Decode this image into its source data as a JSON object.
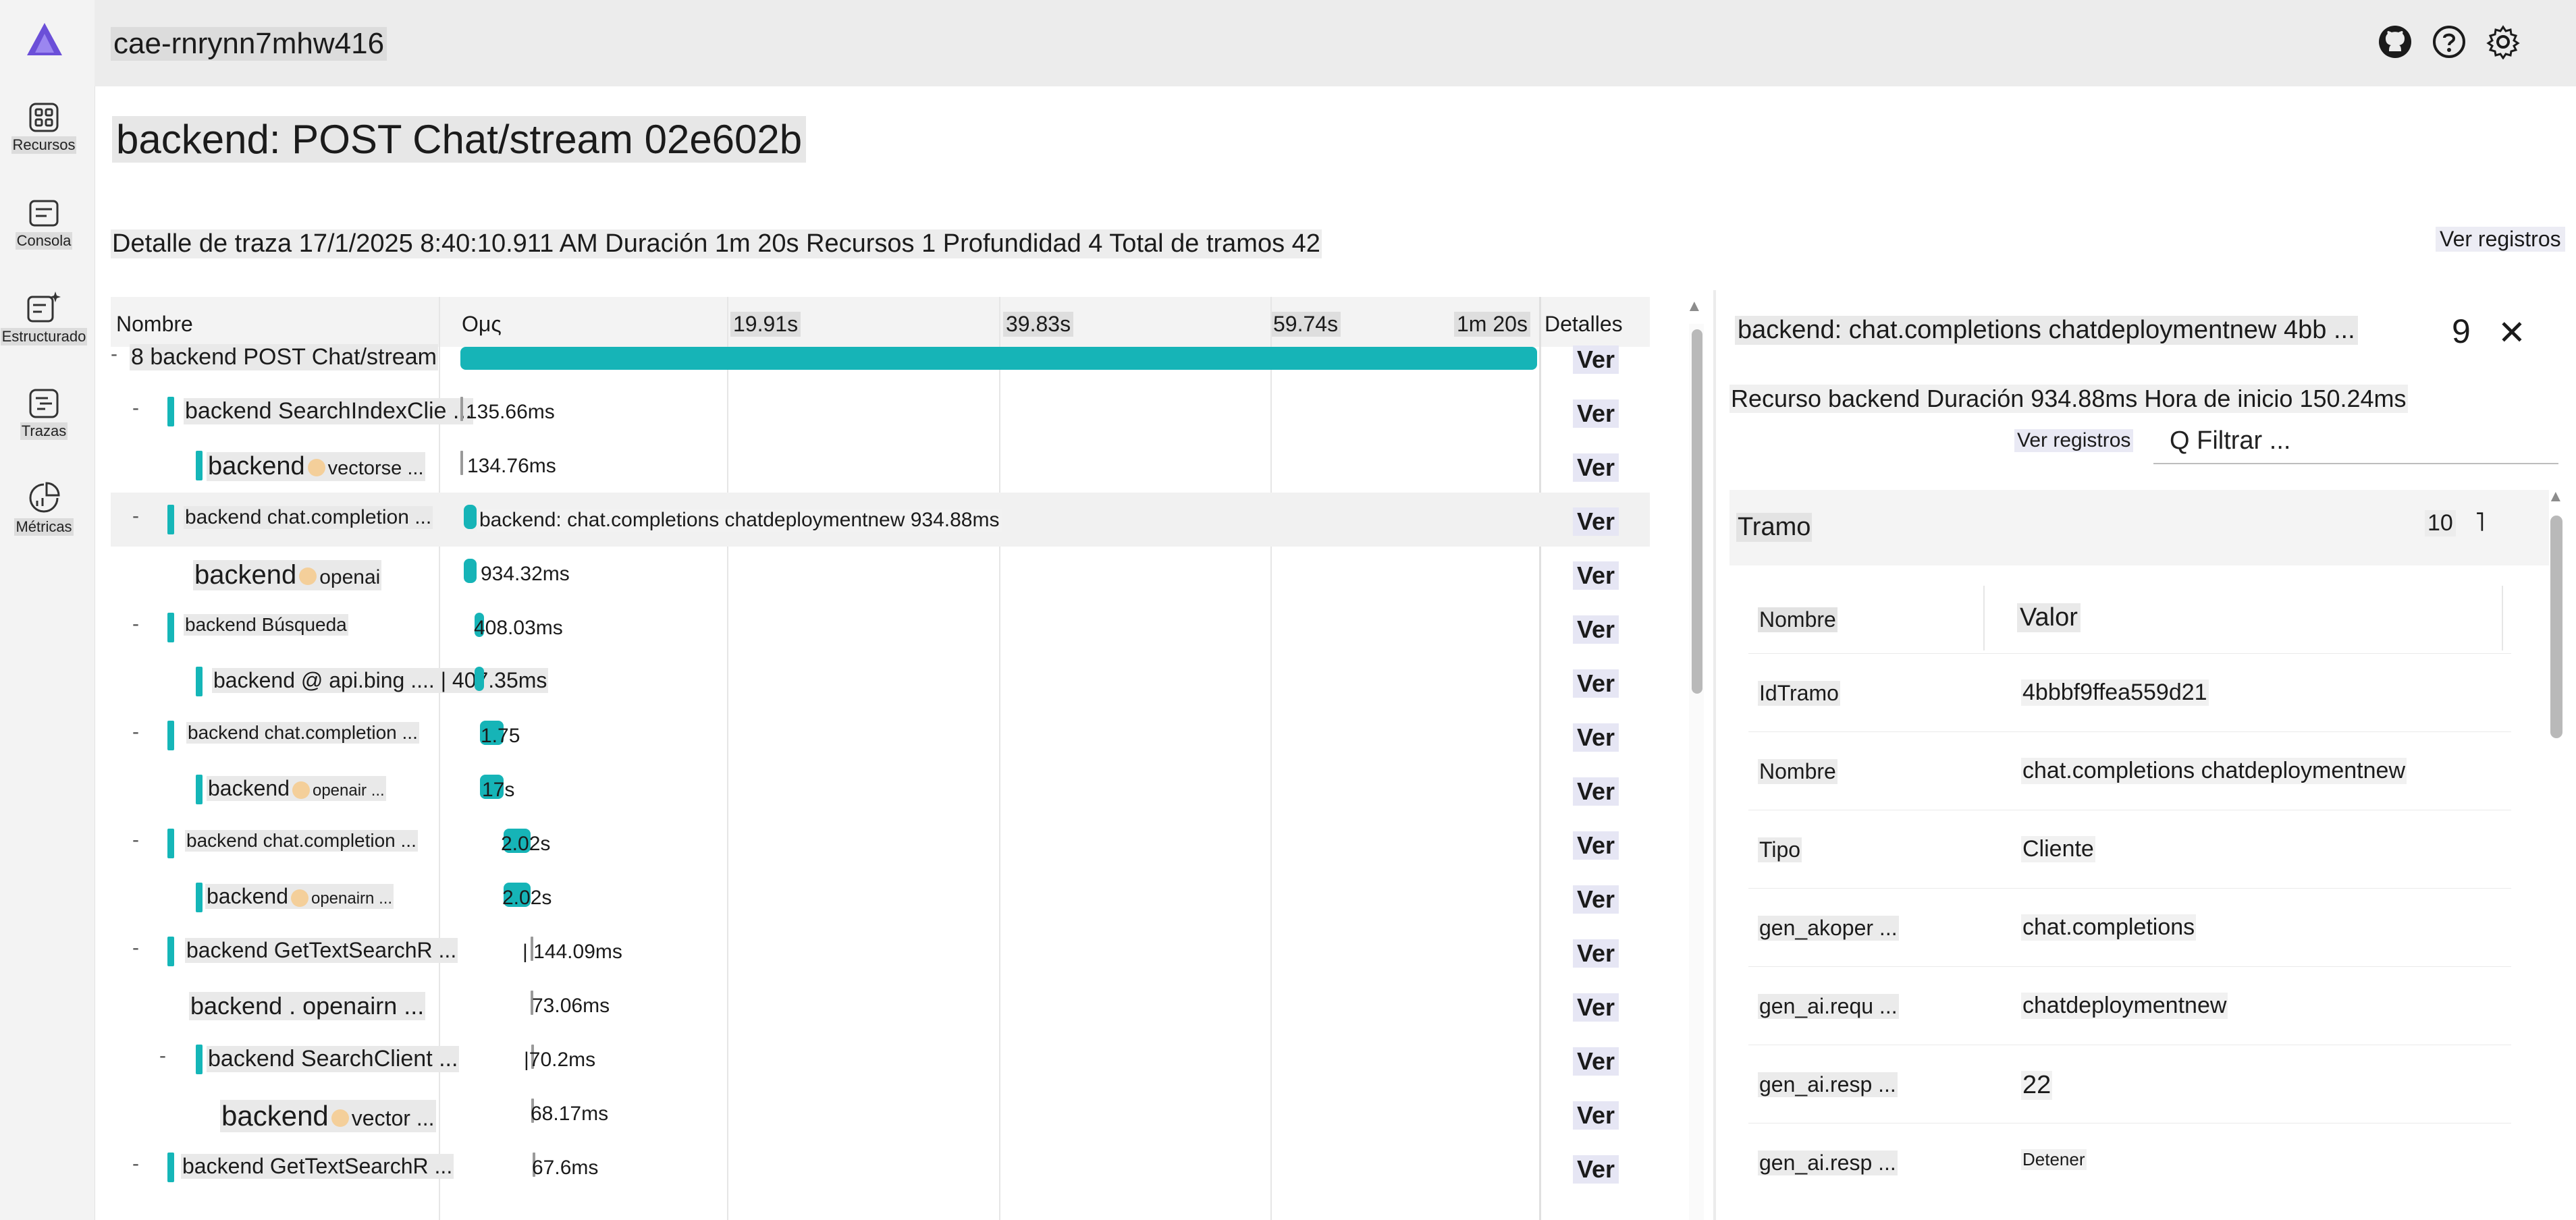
{
  "app": {
    "name": "cae-rnrynn7mhw416"
  },
  "rail": [
    {
      "label": "Recursos",
      "icon": "resources-grid-icon"
    },
    {
      "label": "Consola",
      "icon": "console-icon"
    },
    {
      "label": "Estructurado",
      "icon": "structured-logs-icon"
    },
    {
      "label": "Trazas",
      "icon": "traces-icon"
    },
    {
      "label": "Métricas",
      "icon": "metrics-icon"
    }
  ],
  "header_icons": [
    "github-icon",
    "help-icon",
    "settings-gear-icon"
  ],
  "page": {
    "title": "backend: POST Chat/stream 02e602b",
    "detail": "Detalle de traza 17/1/2025 8:40:10.911 AM Duración 1m 20s Recursos 1 Profundidad 4 Total de tramos 42",
    "view_logs": "Ver registros"
  },
  "table": {
    "col_name": "Nombre",
    "col_details": "Detalles",
    "ticks": [
      "Ομς",
      "19.91s",
      "39.83s",
      "59.74s",
      "1m 20s"
    ],
    "view_label": "Ver",
    "rows": [
      {
        "toggle": "-",
        "name": "8 backend POST Chat/stream",
        "dur": "",
        "bar_start": 0.0,
        "bar_frac": 1.0
      },
      {
        "toggle": "-",
        "name": "backend SearchIndexClie ...",
        "dur": "135.66ms",
        "bar_start": 0.0,
        "bar_frac": 0.0017
      },
      {
        "toggle": "",
        "svc": "backend",
        "sub": "vectorse ...",
        "dur": "134.76ms",
        "bar_start": 0.0,
        "bar_frac": 0.0017
      },
      {
        "toggle": "-",
        "name": "backend chat.completion ...",
        "dur": "backend: chat.completions chatdeploymentnew 934.88ms",
        "bar_start": 0.003,
        "bar_frac": 0.012
      },
      {
        "toggle": "",
        "svc": "backend",
        "sub": "openai",
        "dur": "934.32ms",
        "bar_start": 0.003,
        "bar_frac": 0.012
      },
      {
        "toggle": "-",
        "name": "backend Búsqueda",
        "dur": "408.03ms",
        "bar_start": 0.013,
        "bar_frac": 0.005
      },
      {
        "toggle": "",
        "name": "backend @ api.bing .... | 407.35ms",
        "dur": "",
        "bar_start": 0.013,
        "bar_frac": 0.005
      },
      {
        "toggle": "-",
        "name": "backend chat.completion ...",
        "dur": "1.75",
        "bar_start": 0.018,
        "bar_frac": 0.022
      },
      {
        "toggle": "",
        "svc": "backend",
        "sub": "openair ...",
        "dur": "17s",
        "bar_start": 0.018,
        "bar_frac": 0.022
      },
      {
        "toggle": "-",
        "name": "backend chat.completion ...",
        "dur": "2.02s",
        "bar_start": 0.04,
        "bar_frac": 0.025
      },
      {
        "toggle": "",
        "svc": "backend",
        "sub": "openairn ...",
        "dur": "2.02s",
        "bar_start": 0.04,
        "bar_frac": 0.025
      },
      {
        "toggle": "-",
        "name": "backend GetTextSearchR ...",
        "dur": "| 144.09ms",
        "bar_start": 0.065,
        "bar_frac": 0.0018
      },
      {
        "toggle": "",
        "name": "backend . openairn ...",
        "dur": "73.06ms",
        "bar_start": 0.065,
        "bar_frac": 0.0009
      },
      {
        "toggle": "-",
        "name": "backend SearchClient ...",
        "dur": "|70.2ms",
        "bar_start": 0.066,
        "bar_frac": 0.0009
      },
      {
        "toggle": "",
        "svc": "backend",
        "sub": "vector ...",
        "dur": "68.17ms",
        "bar_start": 0.066,
        "bar_frac": 0.0009
      },
      {
        "toggle": "-",
        "name": "backend GetTextSearchR ...",
        "dur": "67.6ms",
        "bar_start": 0.067,
        "bar_frac": 0.0008
      }
    ]
  },
  "panel": {
    "title": "backend: chat.completions chatdeploymentnew 4bb ...",
    "num": "9",
    "close": "✕",
    "summary": "Recurso backend Duración 934.88ms Hora de inicio 150.24ms",
    "view_logs": "Ver registros",
    "filter_placeholder": "Q Filtrar ...",
    "section_title": "Tramo",
    "section_count": "10",
    "attr_name_header": "Nombre",
    "attr_value_header": "Valor",
    "attrs": [
      {
        "k": "IdTramo",
        "v": "4bbbf9ffea559d21"
      },
      {
        "k": "Nombre",
        "v": "chat.completions chatdeploymentnew"
      },
      {
        "k": "Tipo",
        "v": "Cliente"
      },
      {
        "k": "gen_akoper ...",
        "v": "chat.completions"
      },
      {
        "k": "gen_ai.requ ...",
        "v": "chatdeploymentnew"
      },
      {
        "k": "gen_ai.resp ...",
        "v": "22"
      },
      {
        "k": "gen_ai.resp ...",
        "v": "Detener"
      }
    ]
  },
  "colors": {
    "accent_teal": "#16b4b7",
    "dot": "#f4cf9a",
    "logo": "#6b4fd8"
  }
}
